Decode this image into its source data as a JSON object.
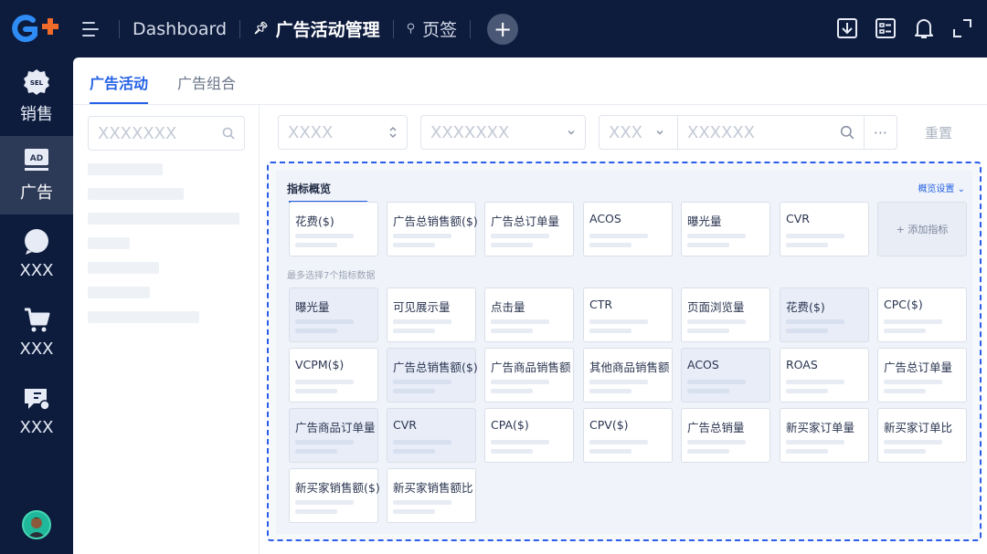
{
  "topbar": {
    "tabs": [
      {
        "label": "Dashboard"
      },
      {
        "label": "广告活动管理"
      },
      {
        "label": "页签"
      }
    ],
    "add_tab": "+"
  },
  "nav": {
    "items": [
      {
        "label": "销售",
        "badge": "SEL",
        "icon": "sales-icon"
      },
      {
        "label": "广告",
        "badge": "AD",
        "icon": "ad-icon"
      },
      {
        "label": "XXX",
        "icon": "chat-icon"
      },
      {
        "label": "XXX",
        "icon": "cart-icon"
      },
      {
        "label": "XXX",
        "icon": "message-icon"
      }
    ]
  },
  "subtabs": [
    {
      "label": "广告活动"
    },
    {
      "label": "广告组合"
    }
  ],
  "search": {
    "placeholder": "XXXXXXX"
  },
  "filters": {
    "f1": "XXXX",
    "f2": "XXXXXXX",
    "f3a": "XXX",
    "f3b": "XXXXXX",
    "more": "···",
    "reset": "重置"
  },
  "panel": {
    "title": "指标概览",
    "settings": "概览设置 ⌄",
    "hint": "最多选择7个指标数据",
    "add_metric": "+ 添加指标",
    "selected": [
      "花费($)",
      "广告总销售额($)",
      "广告总订单量",
      "ACOS",
      "曝光量",
      "CVR"
    ],
    "options": [
      [
        "曝光量",
        "可见展示量",
        "点击量",
        "CTR",
        "页面浏览量",
        "花费($)",
        "CPC($)"
      ],
      [
        "VCPM($)",
        "广告总销售额($)",
        "广告商品销售额",
        "其他商品销售额",
        "ACOS",
        "ROAS",
        "广告总订单量"
      ],
      [
        "广告商品订单量",
        "CVR",
        "CPA($)",
        "CPV($)",
        "广告总销量",
        "新买家订单量",
        "新买家订单比"
      ],
      [
        "新买家销售额($)",
        "新买家销售额比"
      ]
    ]
  },
  "colors": {
    "nav_bg": "#0d1b3d",
    "accent": "#2461e6",
    "active_nav": "#2d3a57"
  }
}
